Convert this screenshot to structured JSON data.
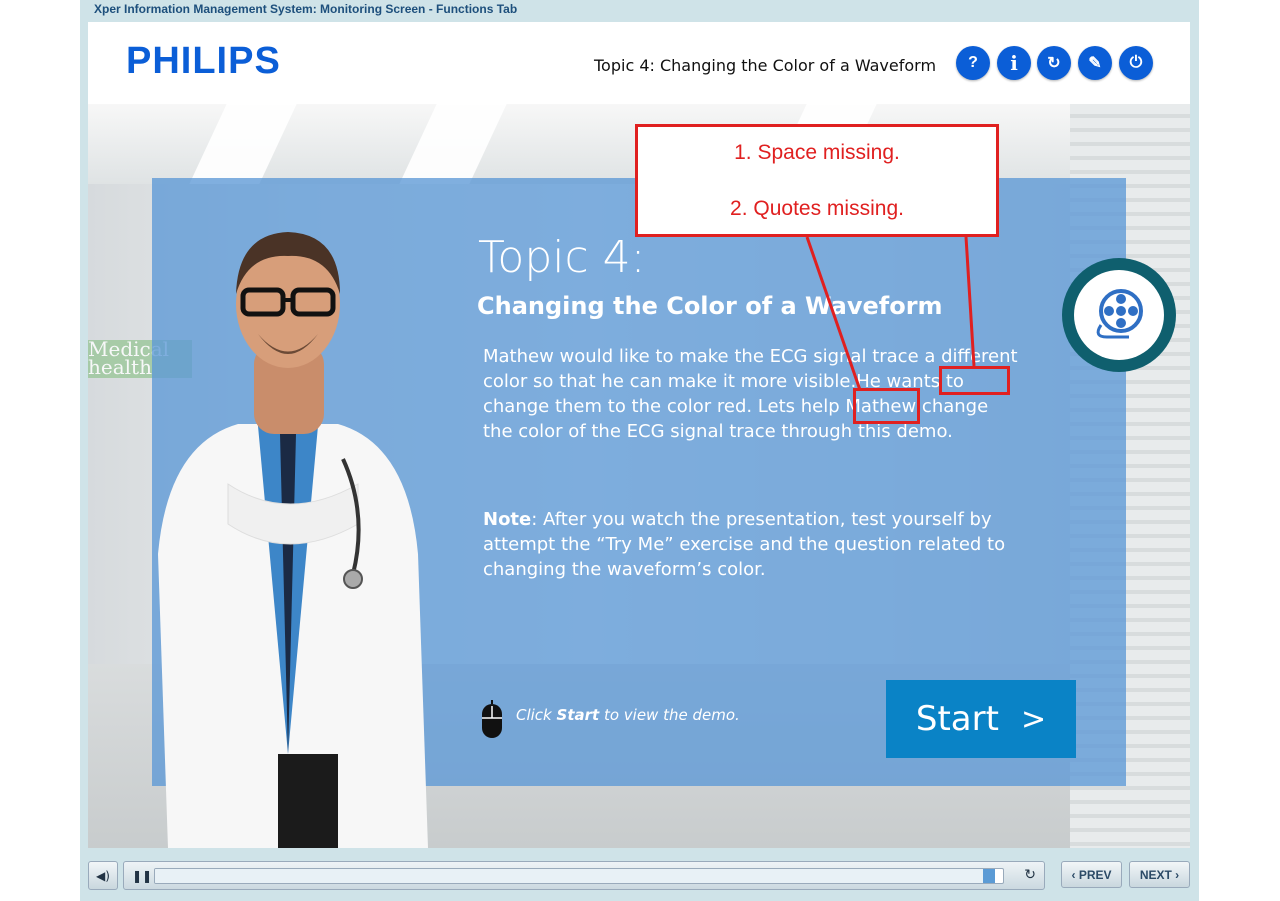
{
  "window": {
    "title": "Xper Information Management System: Monitoring Screen - Functions Tab"
  },
  "header": {
    "logo": "PHILIPS",
    "topic_title": "Topic 4: Changing the Color of a Waveform",
    "buttons": [
      {
        "name": "help",
        "glyph": "?"
      },
      {
        "name": "info",
        "glyph": "i"
      },
      {
        "name": "replay",
        "glyph": "↻"
      },
      {
        "name": "navigate",
        "glyph": "✎"
      },
      {
        "name": "exit",
        "glyph": "⏻"
      }
    ]
  },
  "panel": {
    "topic": "Topic 4:",
    "subtitle": "Changing the Color of a Waveform",
    "body": "Mathew would like to make the ECG signal trace a different color so that he can make it more visible.He wants to change them to the color red. Lets help Mathew change the color of the ECG signal trace through this demo.",
    "note_label": "Note",
    "note_text": ": After you watch the presentation, test yourself by attempt the “Try Me” exercise and the question related to changing the waveform’s color.",
    "click_pre": "Click ",
    "click_bold": "Start",
    "click_post": " to view the demo.",
    "start_label": "Start",
    "start_chevron": ">",
    "background_sign": "Medical health"
  },
  "callout": {
    "line1": "1. Space missing.",
    "line2": "2. Quotes missing."
  },
  "player": {
    "pause_glyph": "❚❚",
    "mute_glyph": "◀)",
    "replay_glyph": "↻",
    "progress": 0.99,
    "prev_label": "PREV",
    "next_label": "NEXT"
  },
  "colors": {
    "brand": "#0b5ed7",
    "panel": "#5c98d6",
    "start": "#0a83c6",
    "annotation": "#e02020"
  }
}
